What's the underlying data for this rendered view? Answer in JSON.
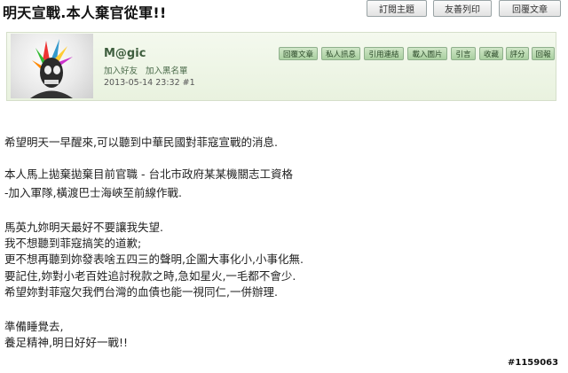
{
  "thread": {
    "title": "明天宣戰.本人棄官從軍!!"
  },
  "top_buttons": [
    "訂閱主題",
    "友善列印",
    "回覆文章"
  ],
  "post": {
    "username": "M@gic",
    "user_links": [
      "加入好友",
      "加入黑名單"
    ],
    "meta": "2013-05-14 23:32  #1",
    "actions": [
      "回覆文章",
      "私人訊息",
      "引用連結",
      "載入圖片",
      "引言",
      "收藏",
      "評分",
      "回報"
    ]
  },
  "body_lines": [
    "希望明天一早醒來,可以聽到中華民國對菲寇宣戰的消息.",
    "本人馬上拋棄拋棄目前官職 - 台北市政府某某機關志工資格",
    "-加入軍隊,橫渡巴士海峽至前線作戰.",
    "馬英九妳明天最好不要讓我失望.",
    "我不想聽到菲寇搞笑的道歉;",
    "更不想再聽到妳發表啥五四三的聲明,企圖大事化小,小事化無.",
    "要記住,妳對小老百姓追討稅款之時,急如星火,一毛都不會少.",
    "希望妳對菲寇欠我們台灣的血債也能一視同仁,一併辦理.",
    "準備睡覺去,",
    "養足精神,明日好好一戰!!"
  ],
  "watermark": "#1159063",
  "icons": {
    "avatar": "avatar-icon"
  },
  "colors": {
    "header_bg": "#eaf3e0",
    "button_green": "#b5d8ab",
    "username": "#3e5e3e"
  }
}
